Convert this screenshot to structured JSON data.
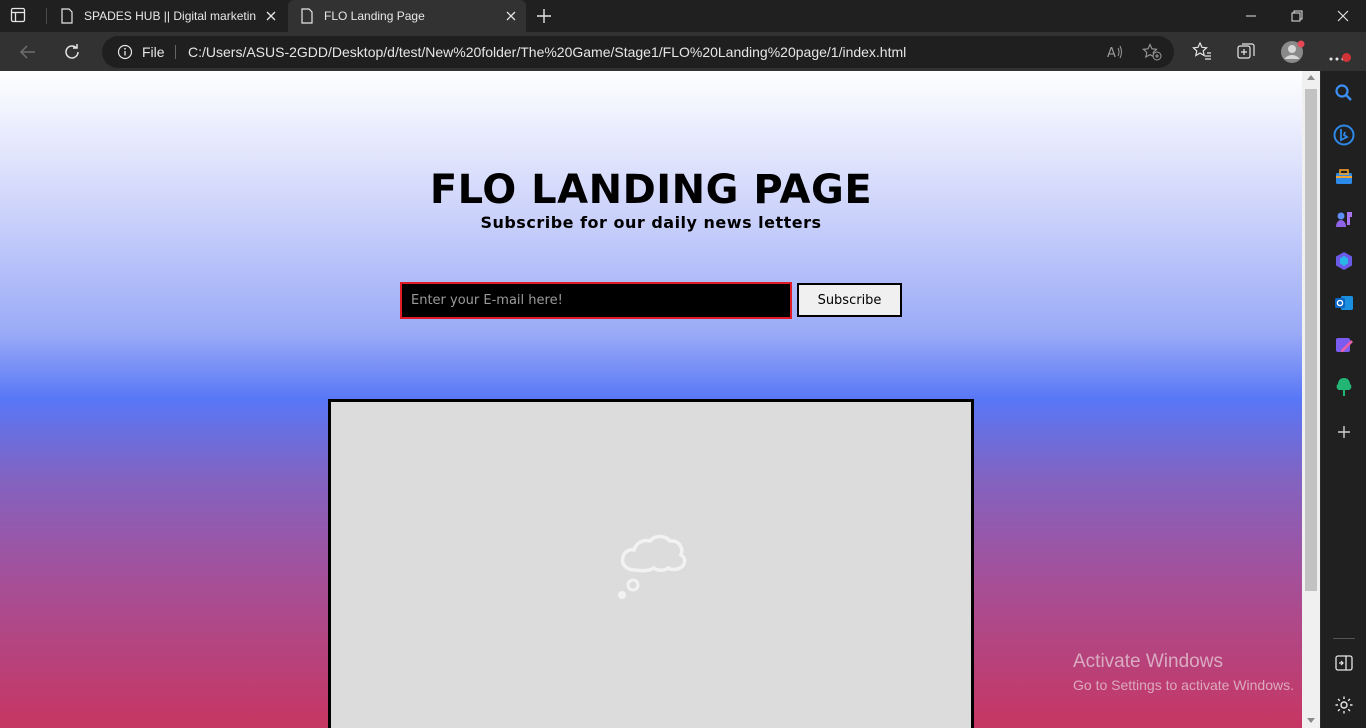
{
  "browser": {
    "tabs": [
      {
        "title": "SPADES HUB || Digital marketing agency"
      },
      {
        "title": "FLO Landing Page"
      }
    ],
    "address": {
      "scheme_label": "File",
      "url": "C:/Users/ASUS-2GDD/Desktop/d/test/New%20folder/The%20Game/Stage1/FLO%20Landing%20page/1/index.html"
    },
    "notification_count": "1",
    "sidebar_icons": [
      "search-icon",
      "bing-icon",
      "shopping-icon",
      "games-icon",
      "copilot-icon",
      "outlook-icon",
      "designer-icon",
      "tree-icon",
      "add-icon",
      "split-screen-icon",
      "settings-icon"
    ]
  },
  "page": {
    "title": "FLO LANDING PAGE",
    "subtitle": "Subscribe for our daily news letters",
    "email_placeholder": "Enter your E-mail here!",
    "subscribe_label": "Subscribe"
  },
  "watermark": {
    "line1": "Activate Windows",
    "line2": "Go to Settings to activate Windows."
  },
  "colors": {
    "input_border": "#e01b24",
    "tab_active": "#323232",
    "chrome_dark": "#202020"
  }
}
